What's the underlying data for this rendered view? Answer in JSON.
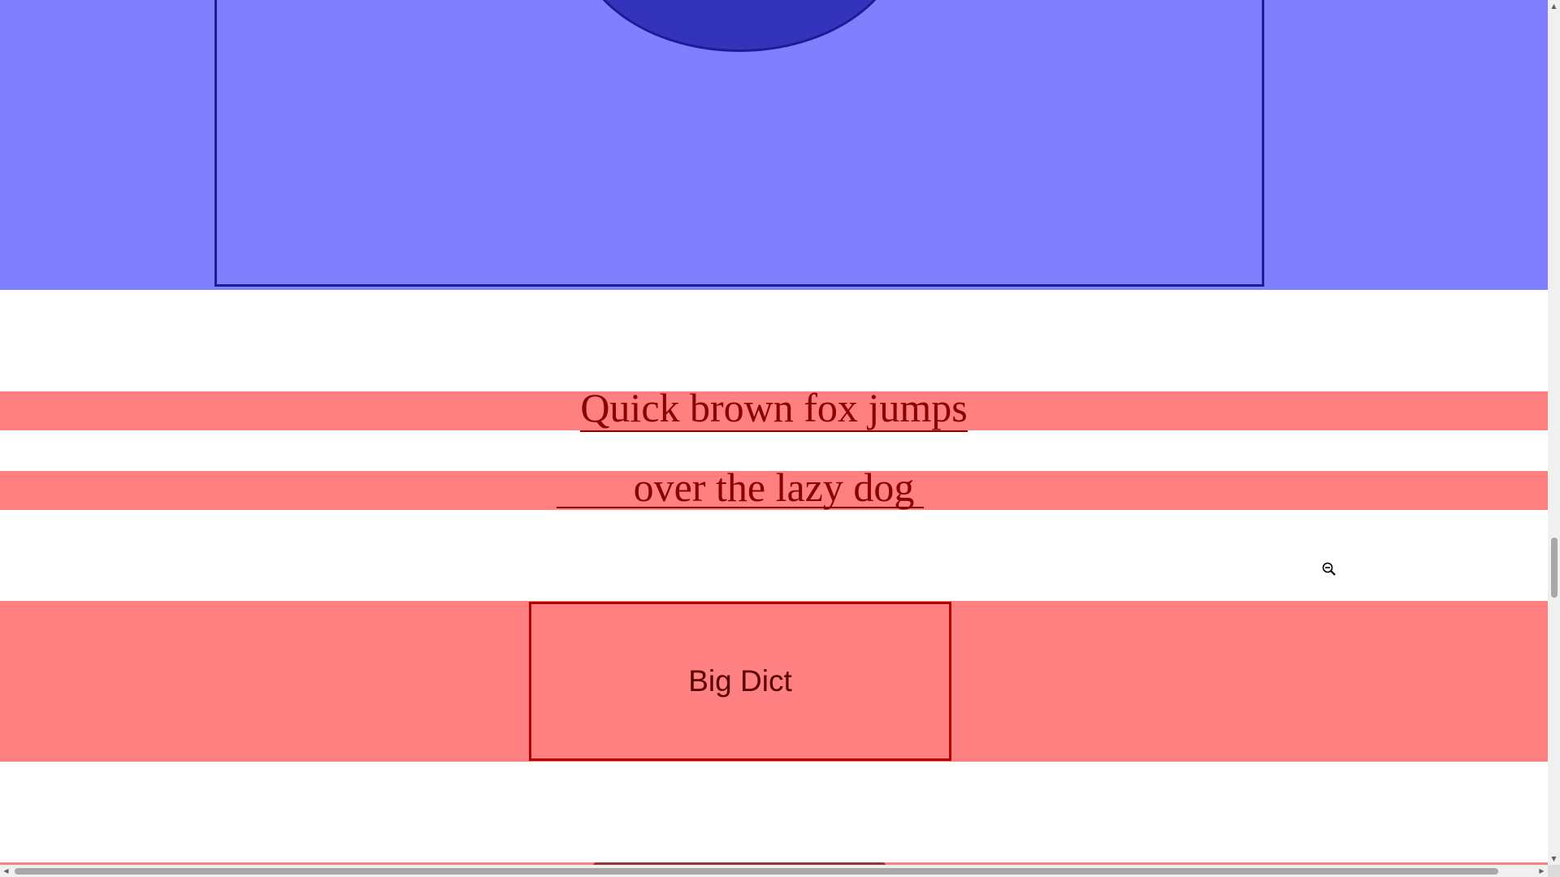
{
  "text": {
    "line1": "Quick brown fox jumps",
    "line2": "over the lazy dog"
  },
  "button": {
    "label": "Big Dict"
  },
  "icons": {
    "cursor": "zoom-out-icon",
    "scroll_up": "arrow-up-icon",
    "scroll_down": "arrow-down-icon",
    "scroll_left": "arrow-left-icon",
    "scroll_right": "arrow-right-icon"
  },
  "colors": {
    "blue_background": "#8080ff",
    "blue_shape": "#3333bb",
    "blue_border": "#1c1c99",
    "red_background": "#ff8080",
    "red_text": "#8b0000",
    "button_border": "#b00000"
  },
  "glyphs": {
    "up": "▲",
    "down": "▼",
    "left": "◀",
    "right": "▶"
  }
}
